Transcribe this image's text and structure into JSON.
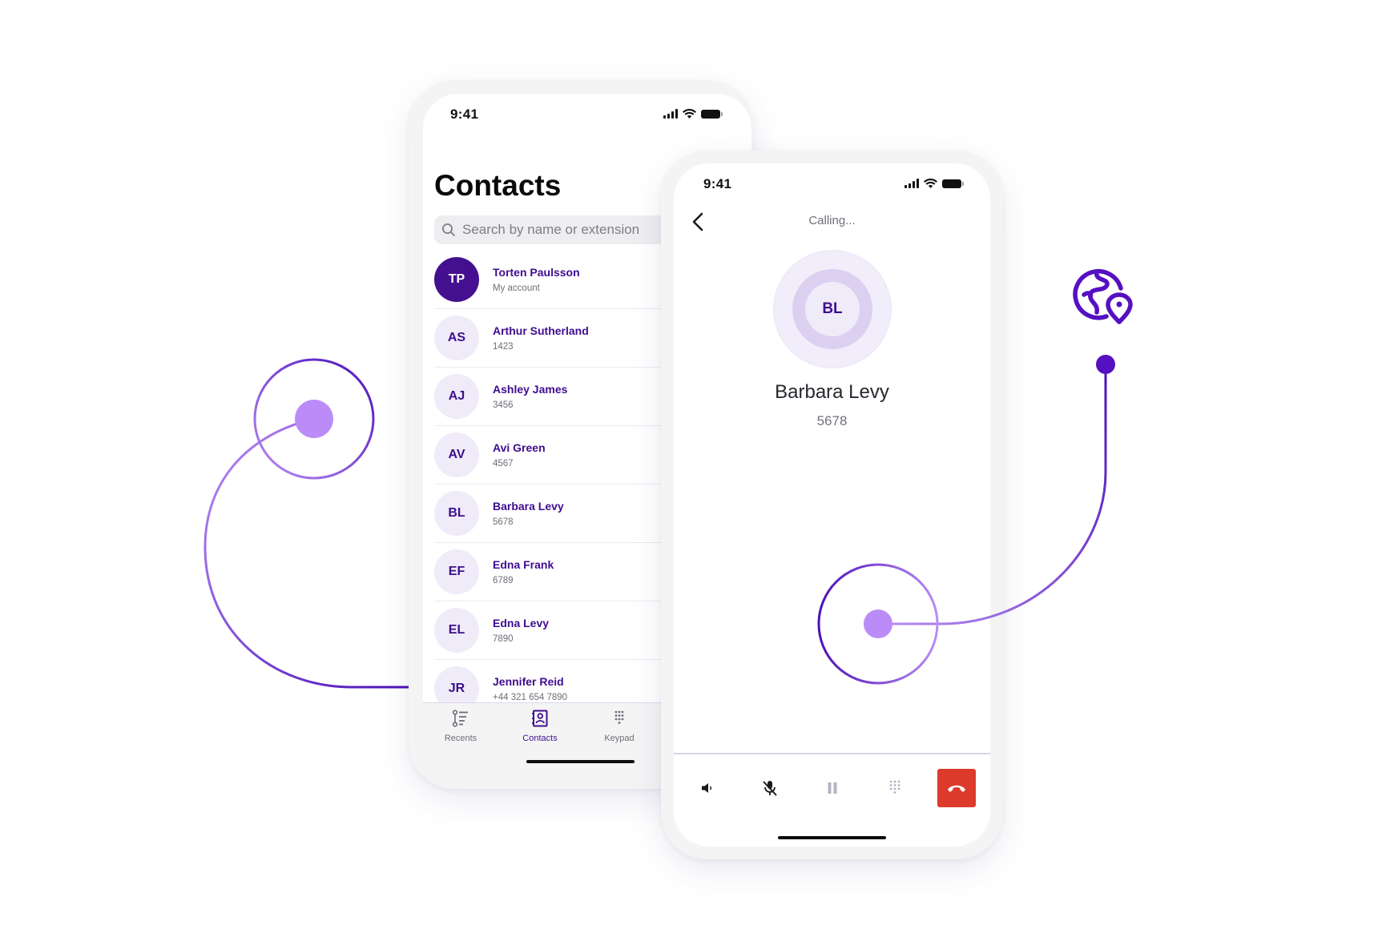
{
  "colors": {
    "brand_purple": "#40108F",
    "accent_lavender": "#BB8CF8",
    "avatar_bg": "#EFEBF8",
    "hangup_red": "#DC3B2B"
  },
  "contacts_screen": {
    "status_time": "9:41",
    "title": "Contacts",
    "search": {
      "placeholder": "Search by name or extension",
      "value": "",
      "icon": "search-icon"
    },
    "contacts": [
      {
        "initials": "TP",
        "name": "Torten Paulsson",
        "detail": "My account",
        "is_self": true
      },
      {
        "initials": "AS",
        "name": "Arthur Sutherland",
        "detail": "1423"
      },
      {
        "initials": "AJ",
        "name": "Ashley James",
        "detail": "3456"
      },
      {
        "initials": "AV",
        "name": "Avi Green",
        "detail": "4567"
      },
      {
        "initials": "BL",
        "name": "Barbara Levy",
        "detail": "5678"
      },
      {
        "initials": "EF",
        "name": "Edna Frank",
        "detail": "6789"
      },
      {
        "initials": "EL",
        "name": "Edna Levy",
        "detail": "7890"
      },
      {
        "initials": "JR",
        "name": "Jennifer Reid",
        "detail": "+44 321 654 7890"
      }
    ],
    "tabs": [
      {
        "label": "Recents",
        "icon": "recents-list-icon",
        "active": false
      },
      {
        "label": "Contacts",
        "icon": "contacts-book-icon",
        "active": true
      },
      {
        "label": "Keypad",
        "icon": "keypad-icon",
        "active": false
      }
    ]
  },
  "call_screen": {
    "status_time": "9:41",
    "status": "Calling...",
    "callee": {
      "initials": "BL",
      "name": "Barbara Levy",
      "extension": "5678"
    },
    "controls": [
      {
        "name": "speaker",
        "icon": "speaker-icon",
        "enabled": true
      },
      {
        "name": "mute",
        "icon": "microphone-off-icon",
        "enabled": true
      },
      {
        "name": "hold",
        "icon": "pause-icon",
        "enabled": false
      },
      {
        "name": "keypad",
        "icon": "keypad-icon",
        "enabled": false
      },
      {
        "name": "hang-up",
        "icon": "phone-hangup-icon",
        "enabled": true
      }
    ]
  },
  "decorations": {
    "globe_icon": "globe-location-pin-icon"
  }
}
